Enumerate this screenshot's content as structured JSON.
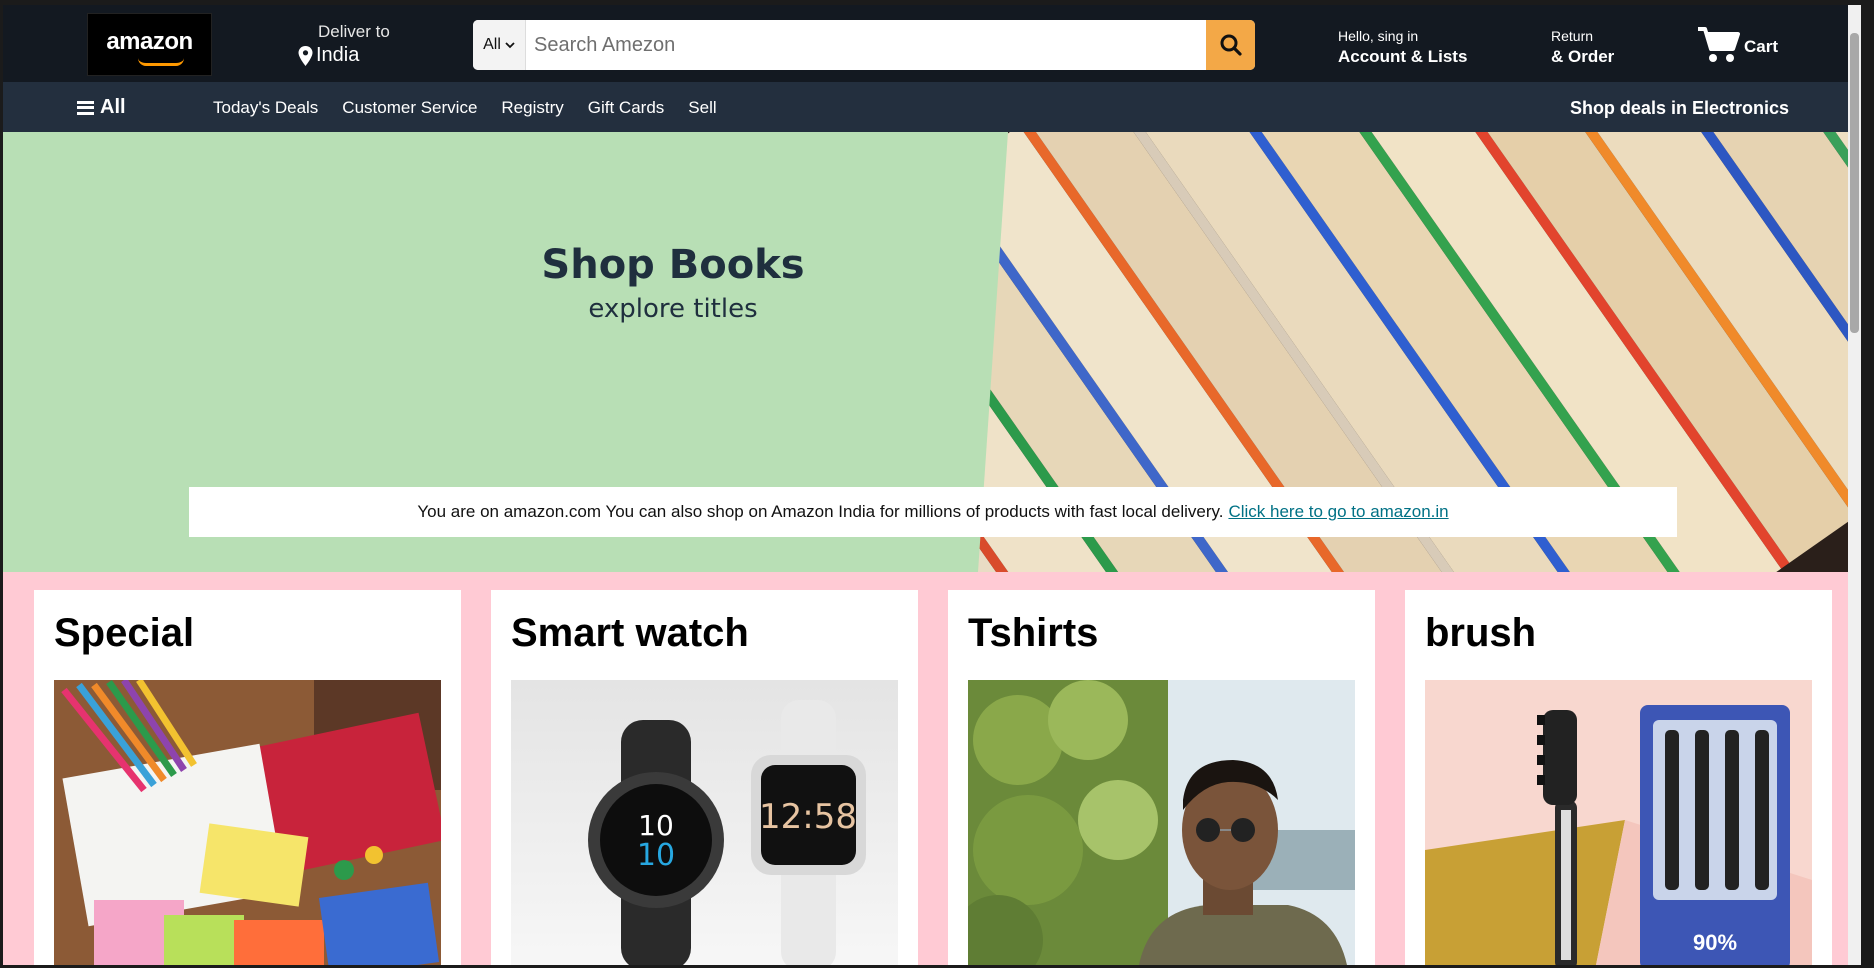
{
  "header": {
    "logo_text": "amazon",
    "deliver_label": "Deliver to",
    "deliver_location": "India",
    "search": {
      "category": "All",
      "placeholder": "Search Amezon",
      "value": ""
    },
    "account_line1": "Hello, sing in",
    "account_line2": "Account & Lists",
    "orders_line1": "Return",
    "orders_line2": "& Order",
    "cart_label": "Cart"
  },
  "subnav": {
    "all_label": "All",
    "links": [
      "Today's Deals",
      "Customer Service",
      "Registry",
      "Gift Cards",
      "Sell"
    ],
    "deals_label": "Shop deals in Electronics"
  },
  "hero": {
    "title": "Shop Books",
    "subtitle": "explore titles",
    "notice_text": "You are on amazon.com You can also shop on Amazon India for millions of products with fast local delivery.",
    "notice_link": "Click here to go to amazon.in"
  },
  "cards": [
    {
      "title": "Special",
      "image": "stationery-image"
    },
    {
      "title": "Smart watch",
      "image": "smartwatch-image"
    },
    {
      "title": "Tshirts",
      "image": "tshirt-model-image"
    },
    {
      "title": "brush",
      "image": "toothbrush-image"
    }
  ],
  "colors": {
    "topnav": "#131921",
    "subnav": "#232f3e",
    "hero_bg": "#b8dfb5",
    "cards_bg": "#ffcad4",
    "search_button": "#f3a847",
    "link": "#007185"
  }
}
